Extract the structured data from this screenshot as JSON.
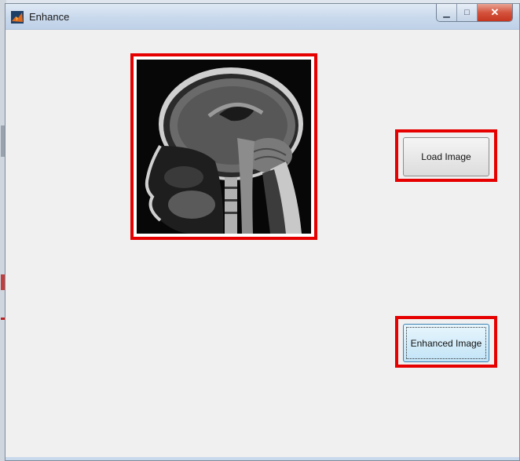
{
  "window": {
    "title": "Enhance",
    "controls": {
      "minimize": "▁",
      "maximize": "□",
      "close": "✕"
    }
  },
  "main": {
    "load_button_label": "Load Image",
    "enhance_button_label": "Enhanced Image"
  },
  "image": {
    "description_tag": "mri-brain-sagittal",
    "caption_marks": ""
  },
  "colors": {
    "highlight": "#e60000",
    "window_bg": "#f0f0f0",
    "enhance_button_bg": "#c2e4f7"
  }
}
